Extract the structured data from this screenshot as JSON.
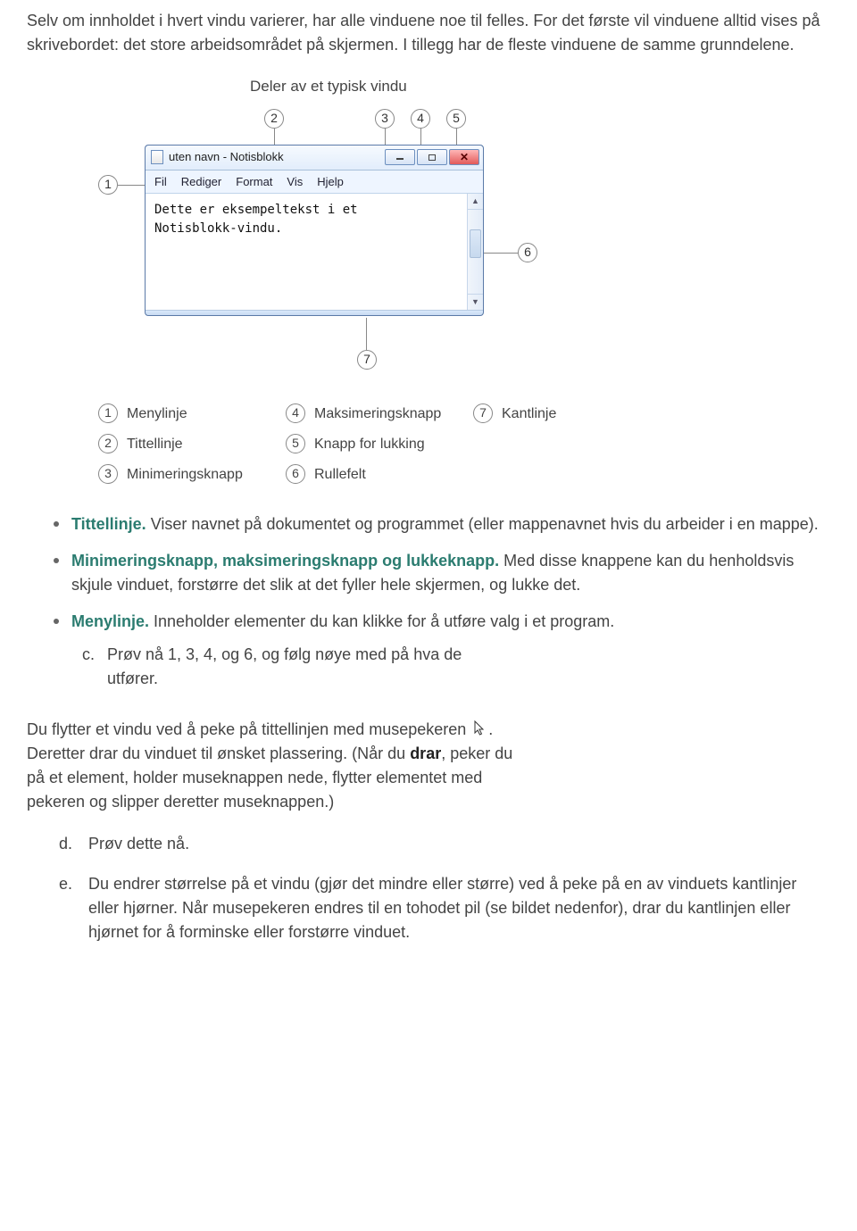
{
  "intro_text": "Selv om innholdet i hvert vindu varierer, har alle vinduene noe til felles. For det første vil vinduene alltid vises på skrivebordet: det store arbeidsområdet på skjermen. I tillegg har de fleste vinduene de samme grunndelene.",
  "caption": "Deler av et typisk vindu",
  "window": {
    "title": "uten navn - Notisblokk",
    "menu": [
      "Fil",
      "Rediger",
      "Format",
      "Vis",
      "Hjelp"
    ],
    "editor_text": "Dette er eksempeltekst i et\nNotisblokk-vindu."
  },
  "callouts": {
    "n1": "1",
    "n2": "2",
    "n3": "3",
    "n4": "4",
    "n5": "5",
    "n6": "6",
    "n7": "7"
  },
  "legend": {
    "l1": "Menylinje",
    "l2": "Tittellinje",
    "l3": "Minimeringsknapp",
    "l4": "Maksimeringsknapp",
    "l5": "Knapp for lukking",
    "l6": "Rullefelt",
    "l7": "Kantlinje"
  },
  "bullets": {
    "b1": {
      "bold": "Tittellinje.",
      "text": " Viser navnet på dokumentet og programmet (eller mappenavnet hvis du arbeider i en mappe)."
    },
    "b2": {
      "bold": "Minimeringsknapp, maksimeringsknapp og lukkeknapp.",
      "text": " Med disse knappene kan du henholdsvis skjule vinduet, forstørre det slik at det fyller hele skjermen, og lukke det."
    },
    "b3": {
      "bold": "Menylinje.",
      "text": " Inneholder elementer du kan klikke for å utføre valg i et program."
    },
    "c_letter": "c.",
    "c_text": "Prøv nå 1, 3, 4, og 6, og følg nøye med på hva de utfører."
  },
  "move_para": {
    "p1": "Du flytter et vindu ved å peke på tittellinjen med musepekeren ",
    "p2": ". Deretter drar du vinduet til ønsket plassering. (Når du ",
    "drar": "drar",
    "p3": ", peker du på et element, holder museknappen nede, flytter elementet med pekeren og slipper deretter museknappen.)"
  },
  "steps": {
    "d_letter": "d.",
    "d_text": "Prøv dette nå.",
    "e_letter": "e.",
    "e_text": "Du endrer størrelse på et vindu (gjør det mindre eller større) ved å peke på en av vinduets kantlinjer eller hjørner. Når musepekeren endres til en tohodet pil (se bildet nedenfor), drar du kantlinjen eller hjørnet for å forminske eller forstørre vinduet."
  }
}
